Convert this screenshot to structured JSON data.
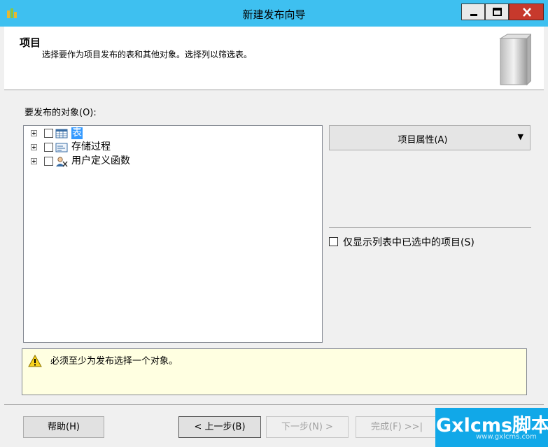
{
  "window": {
    "title": "新建发布向导",
    "buttons": {
      "minimize": "minimize",
      "maximize": "maximize",
      "close": "close"
    }
  },
  "header": {
    "title": "项目",
    "subtitle": "选择要作为项目发布的表和其他对象。选择列以筛选表。"
  },
  "objects": {
    "label": "要发布的对象(O):",
    "items": [
      {
        "label": "表",
        "icon": "table-icon",
        "checked": false,
        "selected": true
      },
      {
        "label": "存储过程",
        "icon": "stored-procedure-icon",
        "checked": false,
        "selected": false
      },
      {
        "label": "用户定义函数",
        "icon": "user-defined-function-icon",
        "checked": false,
        "selected": false
      }
    ]
  },
  "properties_button": {
    "label": "项目属性(A)",
    "arrow": "▼"
  },
  "only_selected": {
    "label": "仅显示列表中已选中的项目(S)",
    "checked": false
  },
  "warning": {
    "text": "必须至少为发布选择一个对象。"
  },
  "buttons": {
    "help": "帮助(H)",
    "back": "< 上一步(B)",
    "next": "下一步(N) >",
    "finish": "完成(F) >>|"
  },
  "watermark": {
    "text": "Gxlcms脚本",
    "sub": "www.gxlcms.com"
  },
  "colors": {
    "titlebar": "#3ec0f0",
    "close": "#c7392c",
    "selection": "#3399ff",
    "warning_bg": "#ffffe1"
  }
}
